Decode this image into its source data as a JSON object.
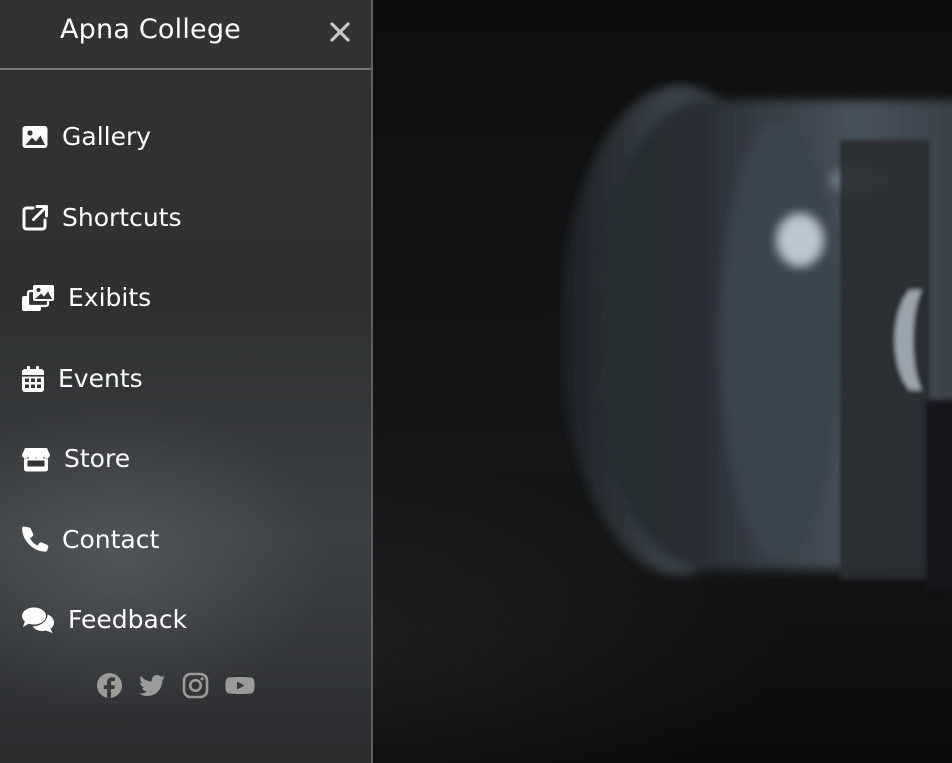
{
  "sidebar": {
    "brand": "Apna College",
    "close_icon": "close-icon",
    "items": [
      {
        "label": "Gallery",
        "icon": "image-icon"
      },
      {
        "label": "Shortcuts",
        "icon": "external-link-icon"
      },
      {
        "label": "Exibits",
        "icon": "photo-stack-icon"
      },
      {
        "label": "Events",
        "icon": "calendar-icon"
      },
      {
        "label": "Store",
        "icon": "store-icon"
      },
      {
        "label": "Contact",
        "icon": "phone-icon"
      },
      {
        "label": "Feedback",
        "icon": "comments-icon"
      }
    ],
    "socials": [
      "facebook-icon",
      "twitter-icon",
      "instagram-icon",
      "youtube-icon"
    ]
  },
  "colors": {
    "text": "#ffffff",
    "icon_muted": "#9a9a98",
    "sidebar_bg": "#333331"
  }
}
